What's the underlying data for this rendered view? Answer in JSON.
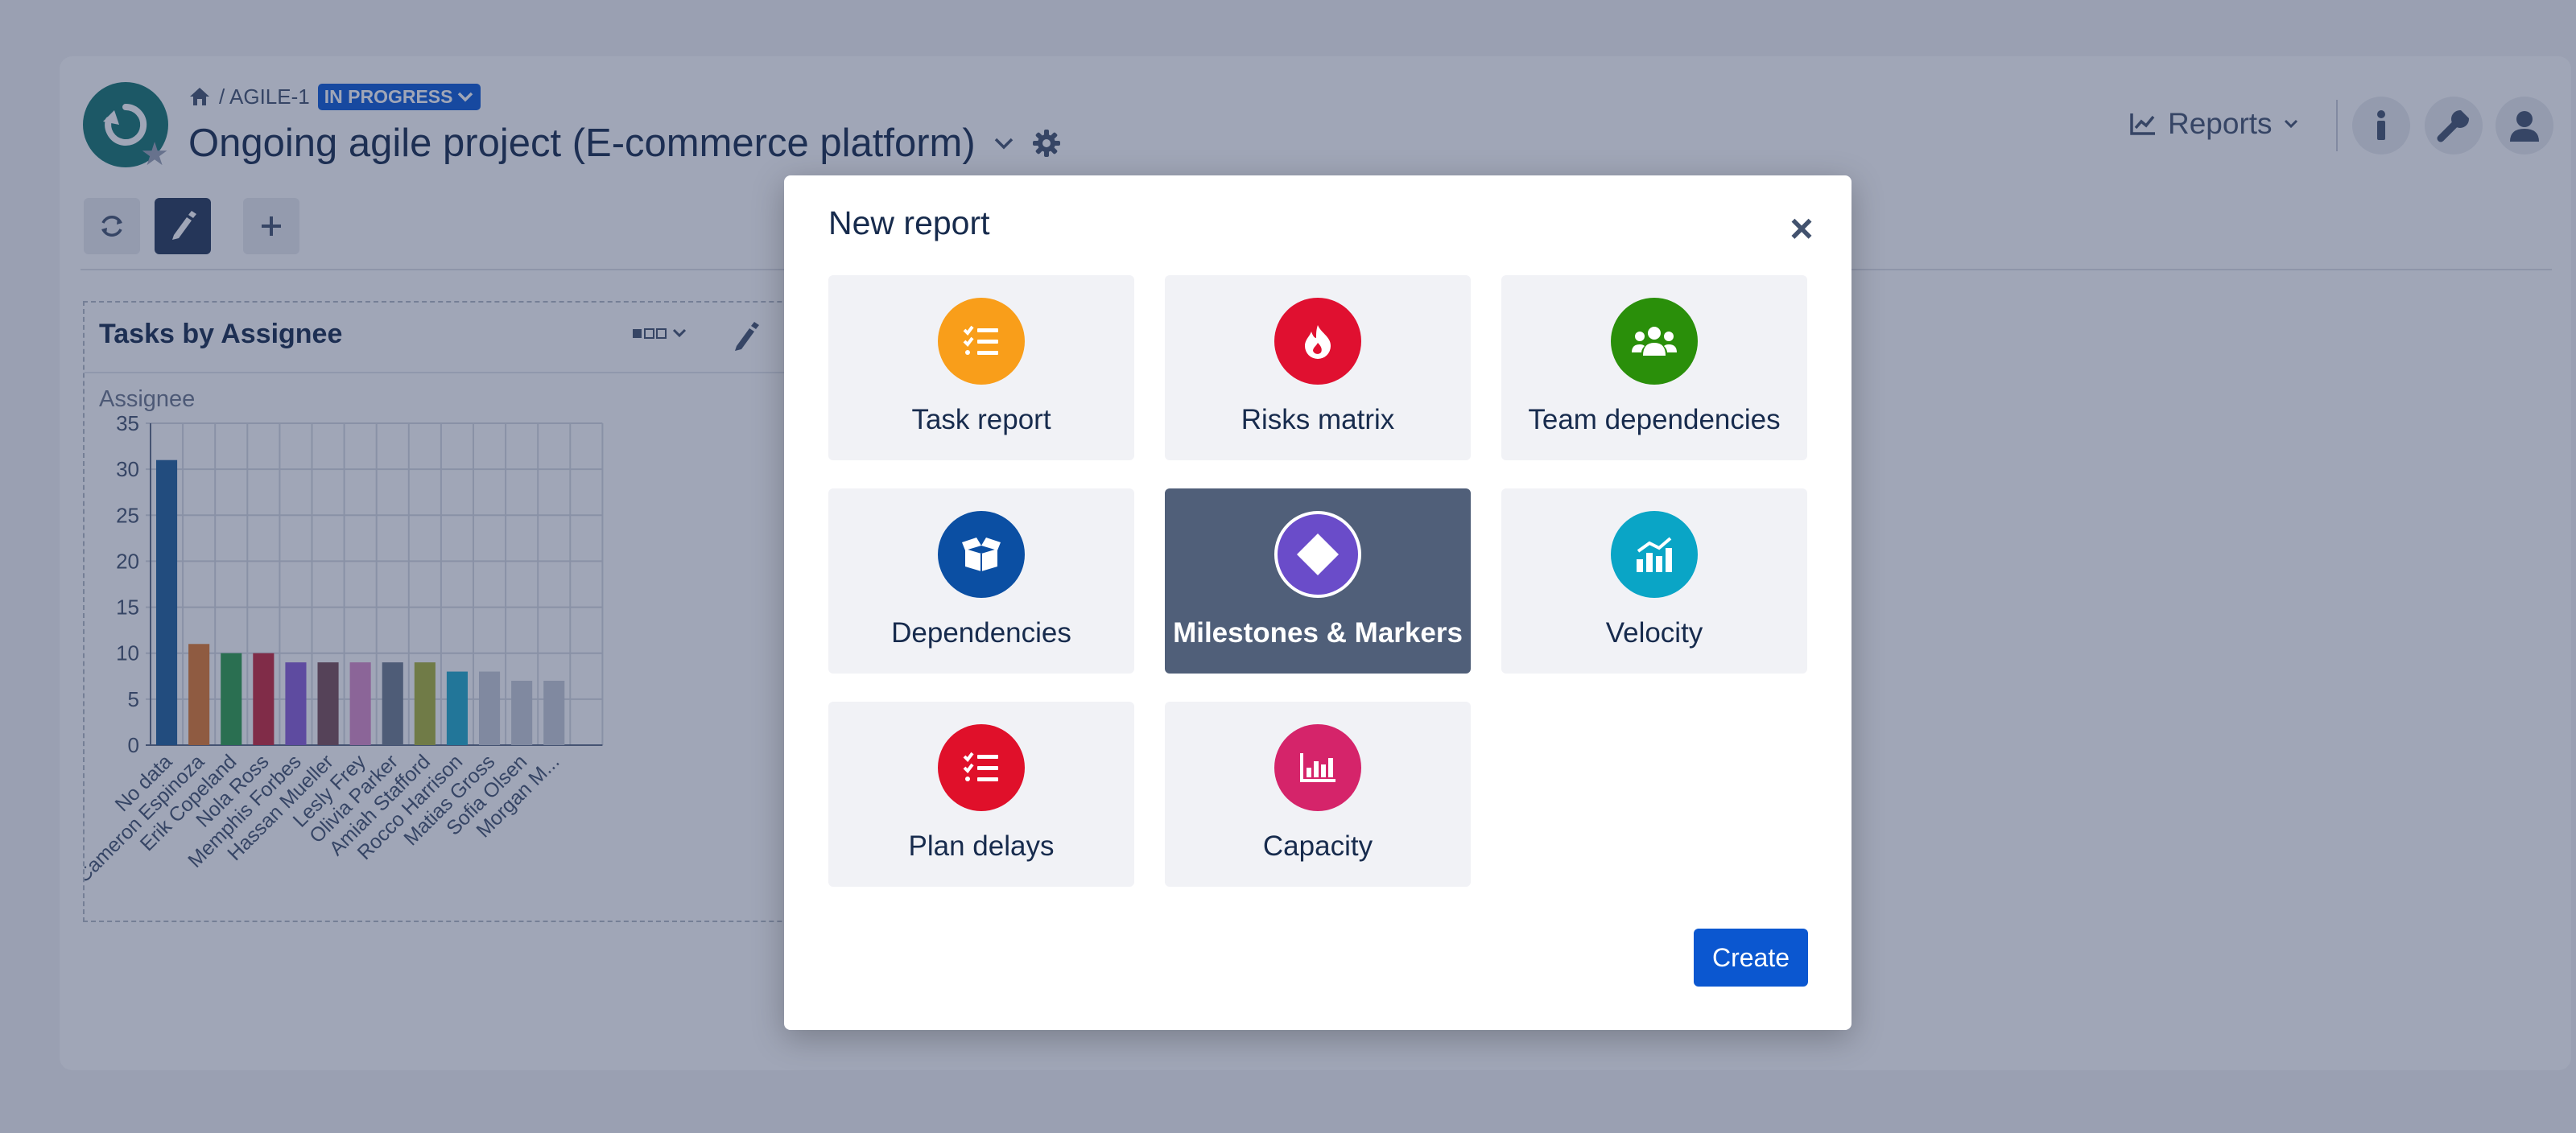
{
  "breadcrumb": {
    "path": "/ AGILE-1",
    "status": "IN PROGRESS"
  },
  "project": {
    "title": "Ongoing agile project (E-commerce platform)"
  },
  "header": {
    "reports_label": "Reports"
  },
  "widget": {
    "title": "Tasks by Assignee",
    "ylabel": "Assignee"
  },
  "chart_data": {
    "type": "bar",
    "title": "Tasks by Assignee",
    "ylabel": "Assignee",
    "ylim": [
      0,
      35
    ],
    "yticks": [
      0,
      5,
      10,
      15,
      20,
      25,
      30,
      35
    ],
    "grid": true,
    "categories": [
      "No data",
      "Cameron Espinoza",
      "Erik Copeland",
      "Nola Ross",
      "Memphis Forbes",
      "Hassan Mueller",
      "Lesly Frey",
      "Olivia Parker",
      "Amiah Stafford",
      "Rocco Harrison",
      "Matias Gross",
      "Sofia Olsen",
      "Morgan M..."
    ],
    "values": [
      31,
      11,
      10,
      10,
      9,
      9,
      9,
      9,
      9,
      8,
      8,
      7,
      7
    ],
    "colors": [
      "#1f5f99",
      "#e07a2e",
      "#2e9e4a",
      "#c7263a",
      "#8a5ed6",
      "#7a4d57",
      "#d98cc8",
      "#6e7b8e",
      "#a9b238",
      "#1fa9c9",
      "#c6ccd7",
      "#c6ccd7",
      "#c6ccd7"
    ]
  },
  "modal": {
    "title": "New report",
    "create_label": "Create",
    "tiles": [
      {
        "label": "Task report",
        "color": "#f99e1a",
        "icon": "checklist-icon"
      },
      {
        "label": "Risks matrix",
        "color": "#e01030",
        "icon": "fire-icon"
      },
      {
        "label": "Team dependencies",
        "color": "#2a8f0a",
        "icon": "users-icon"
      },
      {
        "label": "Dependencies",
        "color": "#0b4fa3",
        "icon": "box-icon"
      },
      {
        "label": "Milestones & Markers",
        "color": "#6a4cc9",
        "icon": "diamond-icon",
        "selected": true
      },
      {
        "label": "Velocity",
        "color": "#0aa5c6",
        "icon": "chart-bar-icon"
      },
      {
        "label": "Plan delays",
        "color": "#e0102a",
        "icon": "checklist-icon"
      },
      {
        "label": "Capacity",
        "color": "#d5246a",
        "icon": "chart-histogram-icon"
      }
    ]
  }
}
